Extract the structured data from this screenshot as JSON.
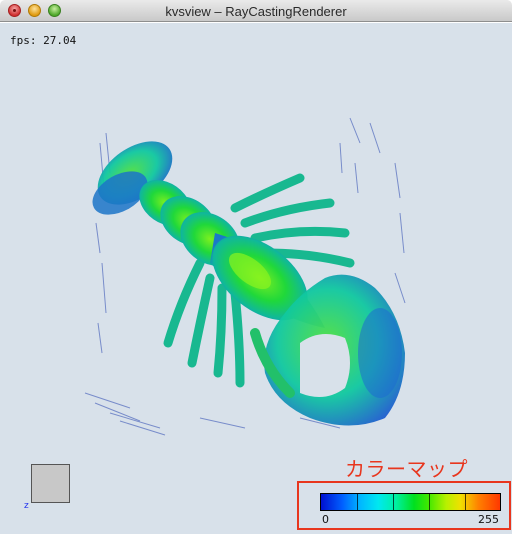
{
  "window": {
    "title": "kvsview – RayCastingRenderer"
  },
  "viewport": {
    "fps_label": "fps: 27.04",
    "axis_label": "z"
  },
  "colormap": {
    "annotation": "カラーマップ",
    "min_label": "0",
    "max_label": "255",
    "colors": [
      "#0010d0",
      "#00b8ff",
      "#00e020",
      "#f0e000",
      "#ff3800"
    ]
  }
}
